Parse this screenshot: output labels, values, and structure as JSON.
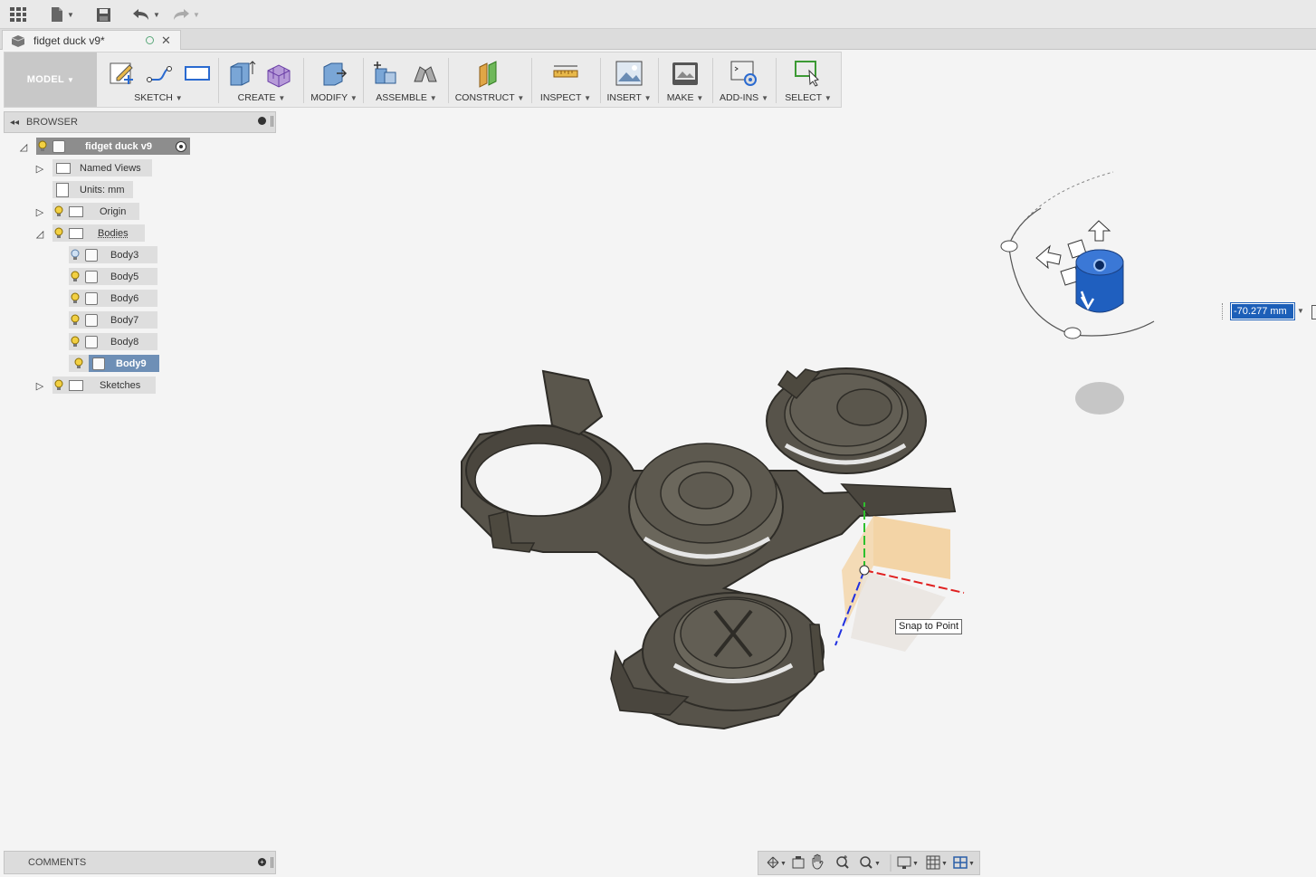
{
  "app": {
    "tab_title": "fidget duck v9*"
  },
  "ribbon": {
    "workspace": "MODEL",
    "groups": [
      "SKETCH",
      "CREATE",
      "MODIFY",
      "ASSEMBLE",
      "CONSTRUCT",
      "INSPECT",
      "INSERT",
      "MAKE",
      "ADD-INS",
      "SELECT"
    ]
  },
  "browser": {
    "title": "BROWSER",
    "root": "fidget duck v9",
    "named_views": "Named Views",
    "units": "Units: mm",
    "origin": "Origin",
    "bodies": "Bodies",
    "body_items": [
      "Body3",
      "Body5",
      "Body6",
      "Body7",
      "Body8",
      "Body9"
    ],
    "selected_body": "Body9",
    "sketches": "Sketches"
  },
  "comments": {
    "title": "COMMENTS"
  },
  "viewport": {
    "tooltip": "Snap to Point",
    "distance_value": "-70.277 mm"
  },
  "colors": {
    "selection": "#6e8fb6",
    "body_fill": "#5a564c",
    "viewcube_blue": "#1f5fbf"
  },
  "icons": {
    "app_menu": "grid-icon",
    "file": "file-icon",
    "save": "save-icon",
    "undo": "undo-icon",
    "redo": "redo-icon"
  }
}
